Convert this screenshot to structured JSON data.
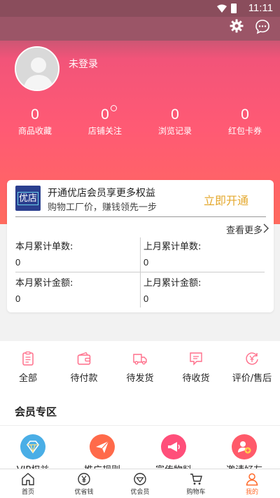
{
  "status_bar": {
    "time": "11:11"
  },
  "profile": {
    "login_text": "未登录"
  },
  "stats": [
    {
      "value": "0",
      "label": "商品收藏"
    },
    {
      "value": "0",
      "label": "店铺关注"
    },
    {
      "value": "0",
      "label": "浏览记录"
    },
    {
      "value": "0",
      "label": "红包卡券"
    }
  ],
  "vip_card": {
    "logo_text": "优店",
    "title": "开通优店会员享更多权益",
    "subtitle": "购物工厂价，赚钱领先一步",
    "open_button": "立即开通",
    "see_more": "查看更多",
    "metrics": [
      {
        "label": "本月累计单数:",
        "value": "0"
      },
      {
        "label": "上月累计单数:",
        "value": "0"
      },
      {
        "label": "本月累计金额:",
        "value": "0"
      },
      {
        "label": "上月累计金额:",
        "value": "0"
      }
    ]
  },
  "orders": [
    {
      "label": "全部",
      "icon": "clipboard-icon"
    },
    {
      "label": "待付款",
      "icon": "wallet-icon"
    },
    {
      "label": "待发货",
      "icon": "truck-icon"
    },
    {
      "label": "待收货",
      "icon": "message-box-icon"
    },
    {
      "label": "评价/售后",
      "icon": "yen-refund-icon"
    }
  ],
  "member_zone": {
    "title": "会员专区",
    "items": [
      {
        "label": "VIP权益",
        "icon": "vip-diamond-icon",
        "color": "#3fa6e0"
      },
      {
        "label": "推广规则",
        "icon": "paper-plane-icon",
        "color": "#ff6a4a"
      },
      {
        "label": "宣传物料",
        "icon": "megaphone-icon",
        "color": "#ff4f7a"
      },
      {
        "label": "邀请好友",
        "icon": "add-user-icon",
        "color": "#ff5a6a"
      }
    ]
  },
  "tabbar": [
    {
      "label": "首页",
      "icon": "home-icon",
      "active": false
    },
    {
      "label": "优省钱",
      "icon": "yen-circle-icon",
      "active": false
    },
    {
      "label": "优会员",
      "icon": "diamond-icon",
      "active": false
    },
    {
      "label": "购物车",
      "icon": "cart-icon",
      "active": false
    },
    {
      "label": "我的",
      "icon": "person-icon",
      "active": true
    }
  ],
  "colors": {
    "accent": "#ff5a74",
    "active_tab": "#ff6a2a",
    "vip_button": "#e4a82d"
  }
}
